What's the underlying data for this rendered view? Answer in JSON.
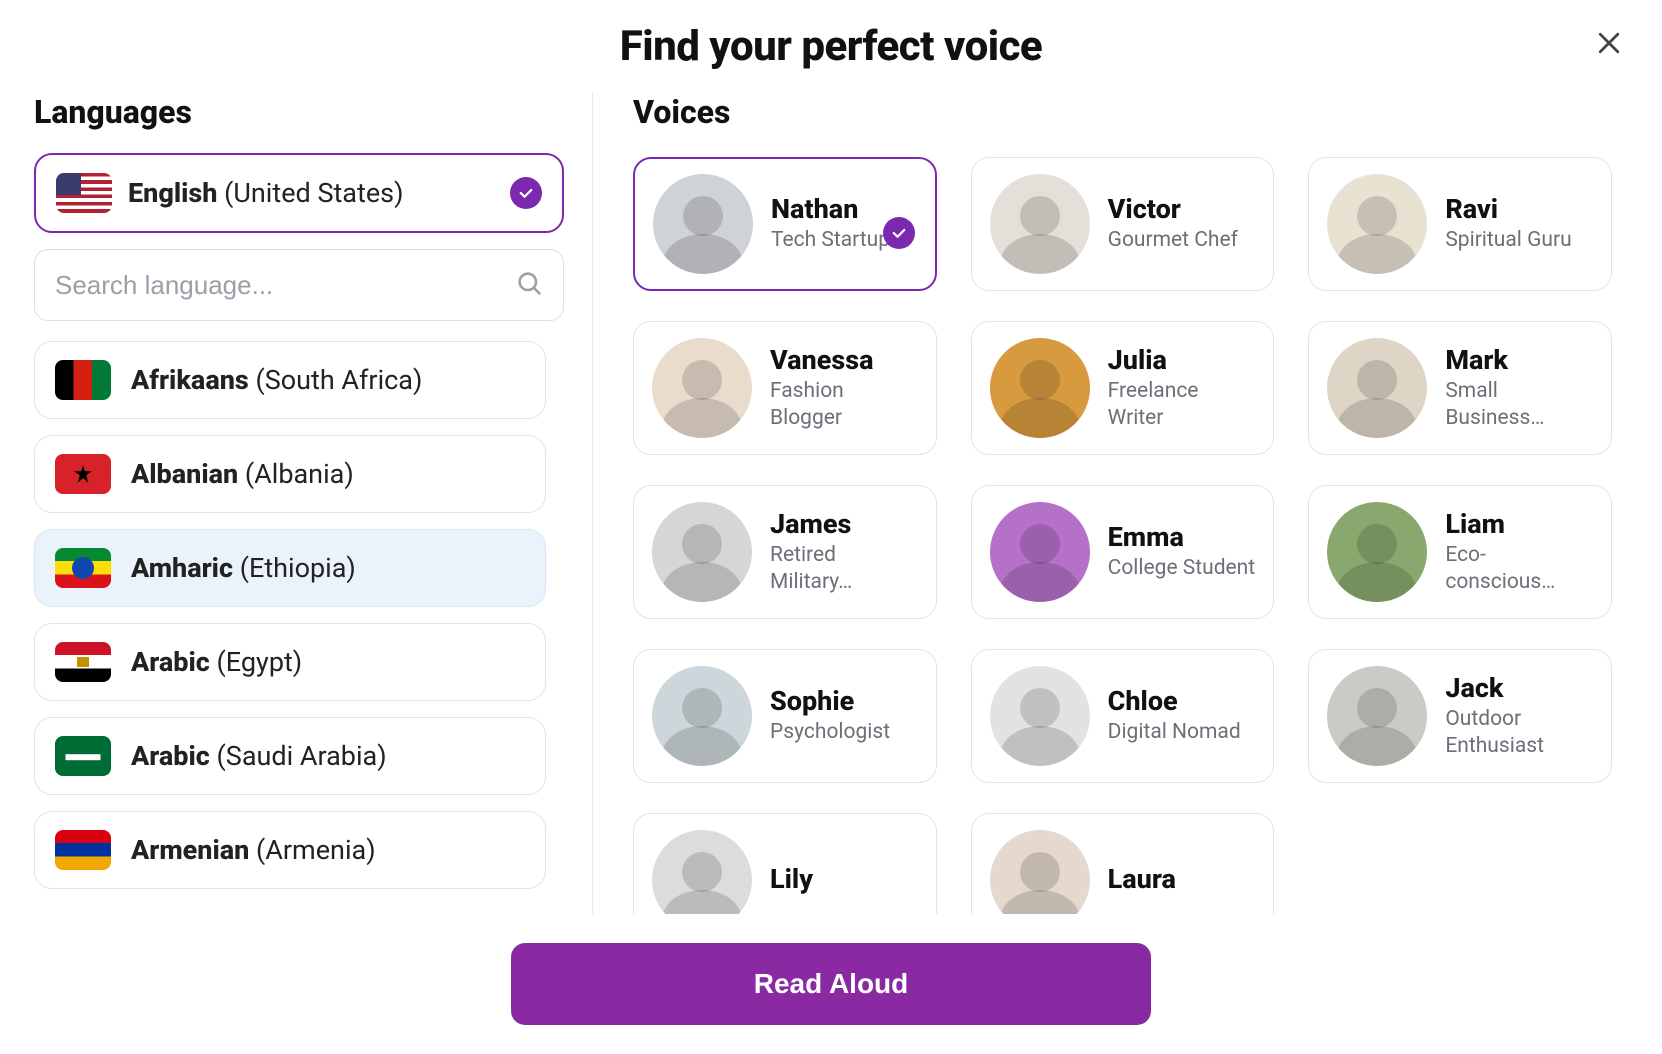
{
  "header": {
    "title": "Find your perfect voice"
  },
  "sidebar": {
    "title": "Languages",
    "selected": {
      "name": "English",
      "region": "(United States)",
      "flag": "usa"
    },
    "search_placeholder": "Search language...",
    "items": [
      {
        "name": "Afrikaans",
        "region": "(South Africa)",
        "flag": "afg",
        "hover": false
      },
      {
        "name": "Albanian",
        "region": "(Albania)",
        "flag": "alb",
        "hover": false
      },
      {
        "name": "Amharic",
        "region": "(Ethiopia)",
        "flag": "eth",
        "hover": true
      },
      {
        "name": "Arabic",
        "region": "(Egypt)",
        "flag": "egy",
        "hover": false
      },
      {
        "name": "Arabic",
        "region": "(Saudi Arabia)",
        "flag": "sau",
        "hover": false
      },
      {
        "name": "Armenian",
        "region": "(Armenia)",
        "flag": "arm",
        "hover": false
      }
    ]
  },
  "voices": {
    "title": "Voices",
    "items": [
      {
        "name": "Nathan",
        "desc": "Tech Startup…",
        "selected": true
      },
      {
        "name": "Victor",
        "desc": "Gourmet Chef",
        "selected": false
      },
      {
        "name": "Ravi",
        "desc": "Spiritual Guru",
        "selected": false
      },
      {
        "name": "Vanessa",
        "desc": "Fashion Blogger",
        "selected": false
      },
      {
        "name": "Julia",
        "desc": "Freelance Writer",
        "selected": false
      },
      {
        "name": "Mark",
        "desc": "Small Business…",
        "selected": false
      },
      {
        "name": "James",
        "desc": "Retired Military…",
        "selected": false
      },
      {
        "name": "Emma",
        "desc": "College Student",
        "selected": false
      },
      {
        "name": "Liam",
        "desc": "Eco-conscious…",
        "selected": false
      },
      {
        "name": "Sophie",
        "desc": "Psychologist",
        "selected": false
      },
      {
        "name": "Chloe",
        "desc": "Digital Nomad",
        "selected": false
      },
      {
        "name": "Jack",
        "desc": "Outdoor Enthusiast",
        "selected": false
      },
      {
        "name": "Lily",
        "desc": "",
        "selected": false
      },
      {
        "name": "Laura",
        "desc": "",
        "selected": false
      }
    ]
  },
  "footer": {
    "button_label": "Read Aloud"
  },
  "colors": {
    "accent": "#7b2ab0",
    "button": "#8a2aa3"
  }
}
